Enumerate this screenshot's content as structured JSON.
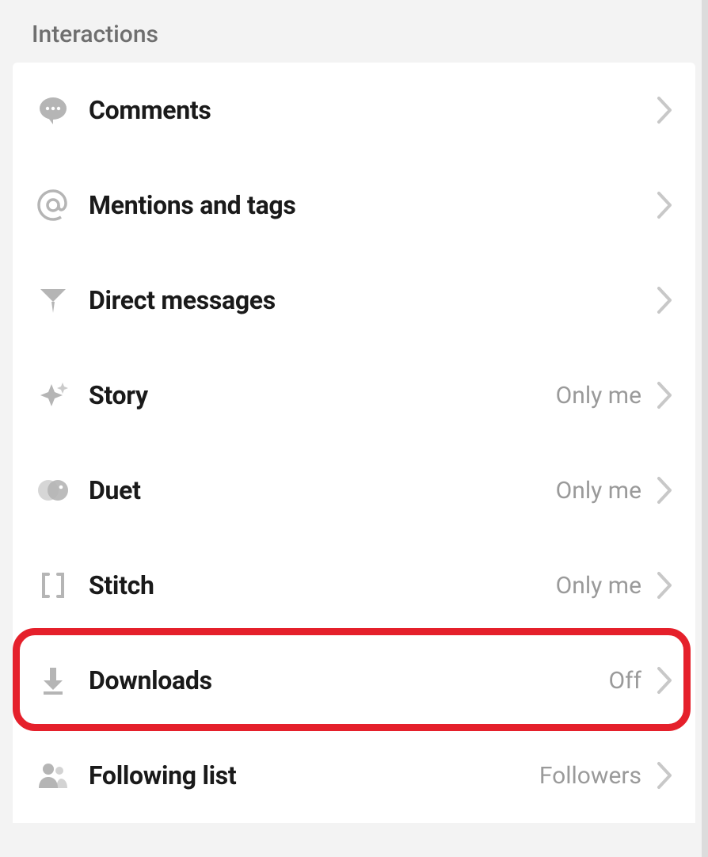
{
  "section": {
    "header": "Interactions"
  },
  "items": [
    {
      "key": "comments",
      "label": "Comments",
      "value": "",
      "icon": "comment-icon"
    },
    {
      "key": "mentions",
      "label": "Mentions and tags",
      "value": "",
      "icon": "mention-icon"
    },
    {
      "key": "dm",
      "label": "Direct messages",
      "value": "",
      "icon": "send-icon"
    },
    {
      "key": "story",
      "label": "Story",
      "value": "Only me",
      "icon": "sparkle-icon"
    },
    {
      "key": "duet",
      "label": "Duet",
      "value": "Only me",
      "icon": "duet-icon"
    },
    {
      "key": "stitch",
      "label": "Stitch",
      "value": "Only me",
      "icon": "stitch-icon"
    },
    {
      "key": "downloads",
      "label": "Downloads",
      "value": "Off",
      "icon": "download-icon",
      "highlight": true
    },
    {
      "key": "following",
      "label": "Following list",
      "value": "Followers",
      "icon": "people-icon"
    }
  ]
}
